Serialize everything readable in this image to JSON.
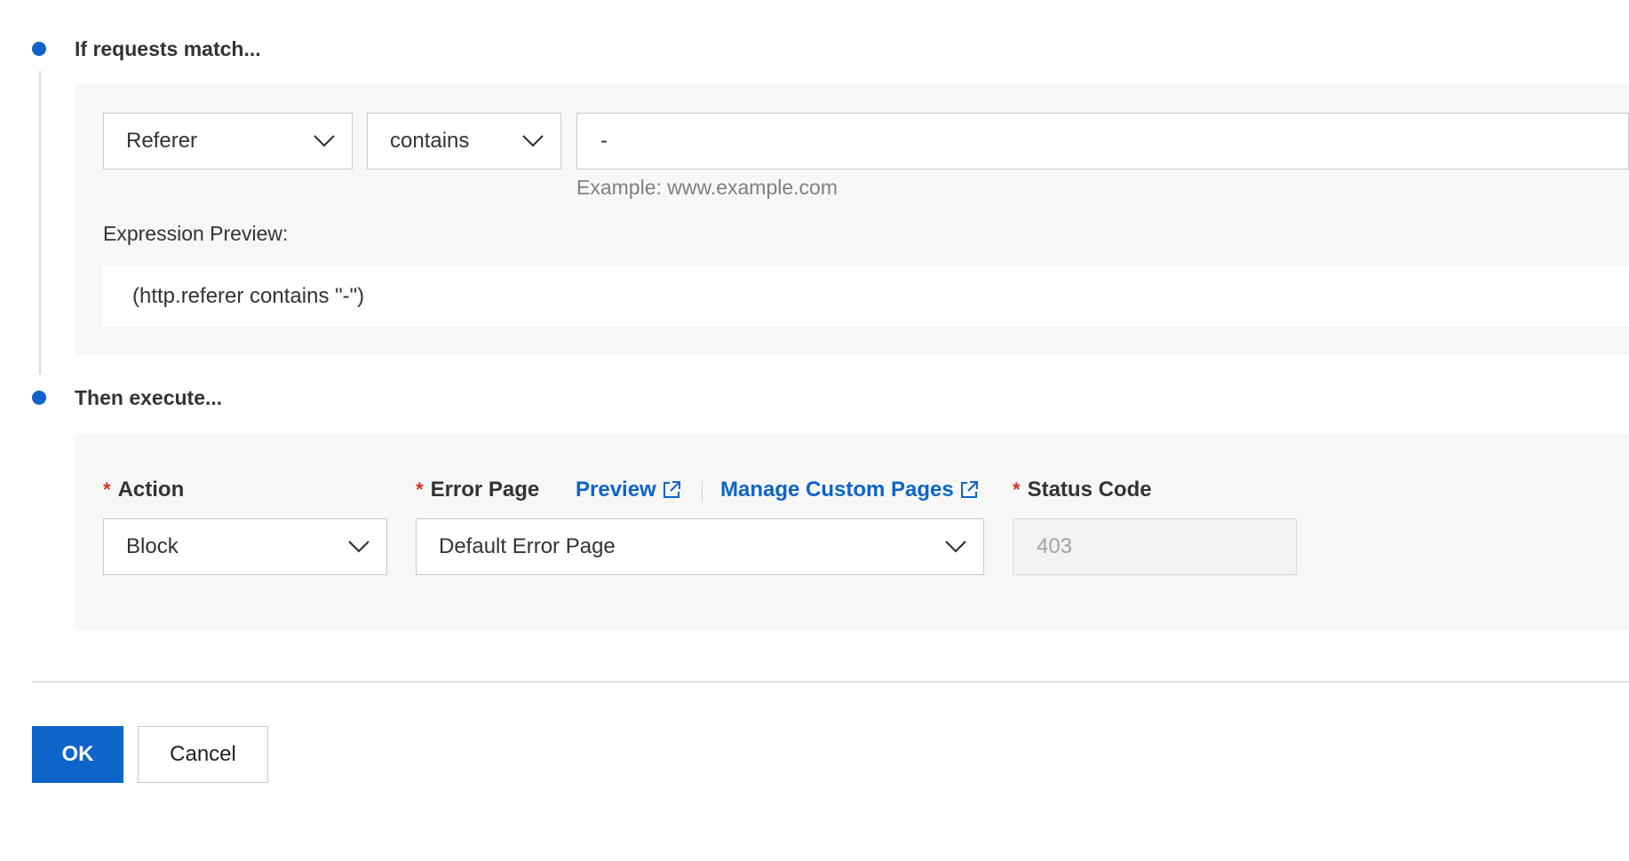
{
  "steps": {
    "match_title": "If requests match...",
    "execute_title": "Then execute..."
  },
  "condition": {
    "field": "Referer",
    "operator": "contains",
    "value": "-",
    "value_hint": "Example: www.example.com",
    "preview_label": "Expression Preview:",
    "preview_expression": "(http.referer contains \"-\")"
  },
  "action_section": {
    "required_mark": "*",
    "action_label": "Action",
    "action_value": "Block",
    "error_page_label": "Error Page",
    "preview_link": "Preview",
    "manage_link": "Manage Custom Pages",
    "error_page_value": "Default Error Page",
    "status_code_label": "Status Code",
    "status_code_value": "403"
  },
  "footer": {
    "ok_label": "OK",
    "cancel_label": "Cancel"
  },
  "colors": {
    "accent": "#0e64c9",
    "required": "#d93026",
    "panel_bg": "#f7f7f7"
  }
}
